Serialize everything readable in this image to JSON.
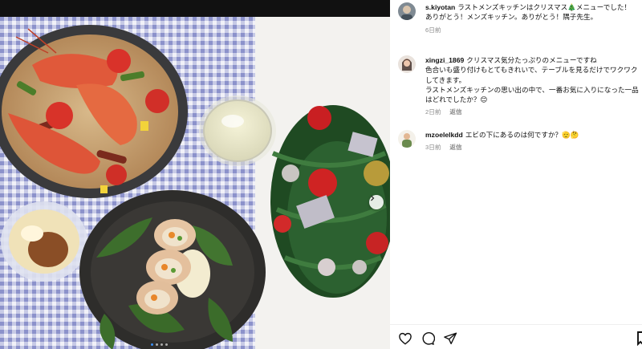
{
  "post": {
    "image_alt": "Christmas dinner with seafood paella, rolled chicken, wine and a small Christmas tree",
    "carousel_dots": 4,
    "active_dot": 0,
    "next_icon": "chevron-right-icon"
  },
  "comments": [
    {
      "username": "s.kiyotan",
      "text": "ラストメンズキッチンはクリスマス🎄メニューでした！\nありがとう！メンズキッチン。ありがとう！隅子先生。",
      "time": "6日前",
      "reply": ""
    },
    {
      "username": "xingzi_1869",
      "text": "クリスマス気分たっぷりのメニューですね\n色合いも盛り付けもとてもきれいで、テーブルを見るだけでワクワクしてきます。\nラストメンズキッチンの思い出の中で、一番お気に入りになった一品はどれでしたか？😊",
      "time": "2日前",
      "reply": "返信"
    },
    {
      "username": "mzoelelkdd",
      "text": "エビの下にあるのは何ですか？🫡🤔",
      "time": "3日前",
      "reply": "返信"
    }
  ],
  "actions": {
    "like_icon": "heart-icon",
    "comment_icon": "comment-icon",
    "share_icon": "send-icon",
    "save_icon": "bookmark-icon"
  },
  "colors": {
    "topbar": "#111111",
    "accent": "#3b8ff5",
    "text": "#111111",
    "muted": "#8a8a8a"
  }
}
